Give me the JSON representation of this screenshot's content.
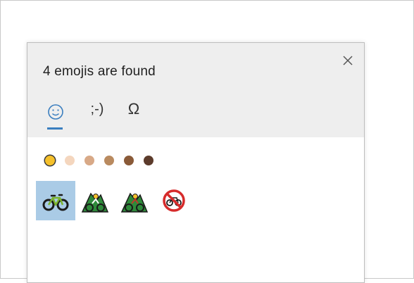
{
  "panel": {
    "title": "4 emojis are found"
  },
  "icons": {
    "close": "close-icon",
    "emoji_tab": "smiley-face-icon",
    "kaomoji_tab": "kaomoji-icon",
    "symbols_tab": "omega-symbol-icon"
  },
  "tabs": [
    {
      "name": "emoji",
      "label": "",
      "active": true
    },
    {
      "name": "kaomoji",
      "label": ";-)"
    },
    {
      "name": "symbols",
      "label": "Ω"
    }
  ],
  "skin_tones": [
    {
      "name": "default",
      "color": "#f5c02b",
      "selected": true
    },
    {
      "name": "light",
      "color": "#f4d6be"
    },
    {
      "name": "medium-light",
      "color": "#d8a987"
    },
    {
      "name": "medium",
      "color": "#b98a5f"
    },
    {
      "name": "medium-dark",
      "color": "#8a5a38"
    },
    {
      "name": "dark",
      "color": "#5c3b2b"
    }
  ],
  "results": [
    {
      "name": "bicycle",
      "icon": "bicycle-emoji",
      "selected": true
    },
    {
      "name": "person-mountain-biking",
      "icon": "mountain-biking-emoji"
    },
    {
      "name": "person-mountain-biking-2",
      "icon": "mountain-biking-emoji"
    },
    {
      "name": "no-bicycles",
      "icon": "no-bicycles-emoji"
    }
  ],
  "colors": {
    "header_bg": "#eeeeee",
    "accent": "#3a7ebf",
    "selection_bg": "#aacbe6"
  }
}
